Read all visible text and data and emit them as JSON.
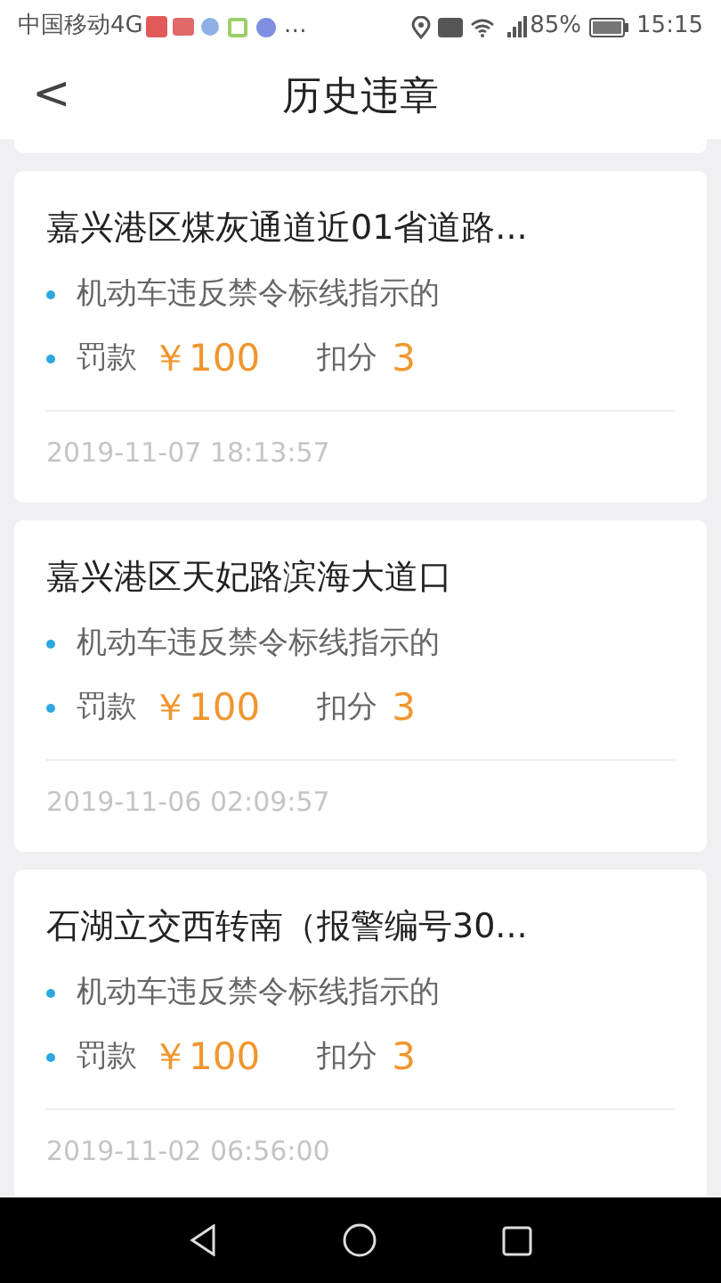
{
  "status_bar": {
    "carrier": "中国移动4G",
    "more": "…",
    "battery": "85%",
    "time": "15:15"
  },
  "header": {
    "back": "<",
    "title": "历史违章"
  },
  "records": [
    {
      "location": "嘉兴港区煤灰通道近01省道路...",
      "violation": "机动车违反禁令标线指示的",
      "fine_label": "罚款",
      "fine": "￥100",
      "points_label": "扣分",
      "points": "3",
      "time": "2019-11-07 18:13:57"
    },
    {
      "location": "嘉兴港区天妃路滨海大道口",
      "violation": "机动车违反禁令标线指示的",
      "fine_label": "罚款",
      "fine": "￥100",
      "points_label": "扣分",
      "points": "3",
      "time": "2019-11-06 02:09:57"
    },
    {
      "location": "石湖立交西转南（报警编号30...",
      "violation": "机动车违反禁令标线指示的",
      "fine_label": "罚款",
      "fine": "￥100",
      "points_label": "扣分",
      "points": "3",
      "time": "2019-11-02 06:56:00"
    }
  ]
}
